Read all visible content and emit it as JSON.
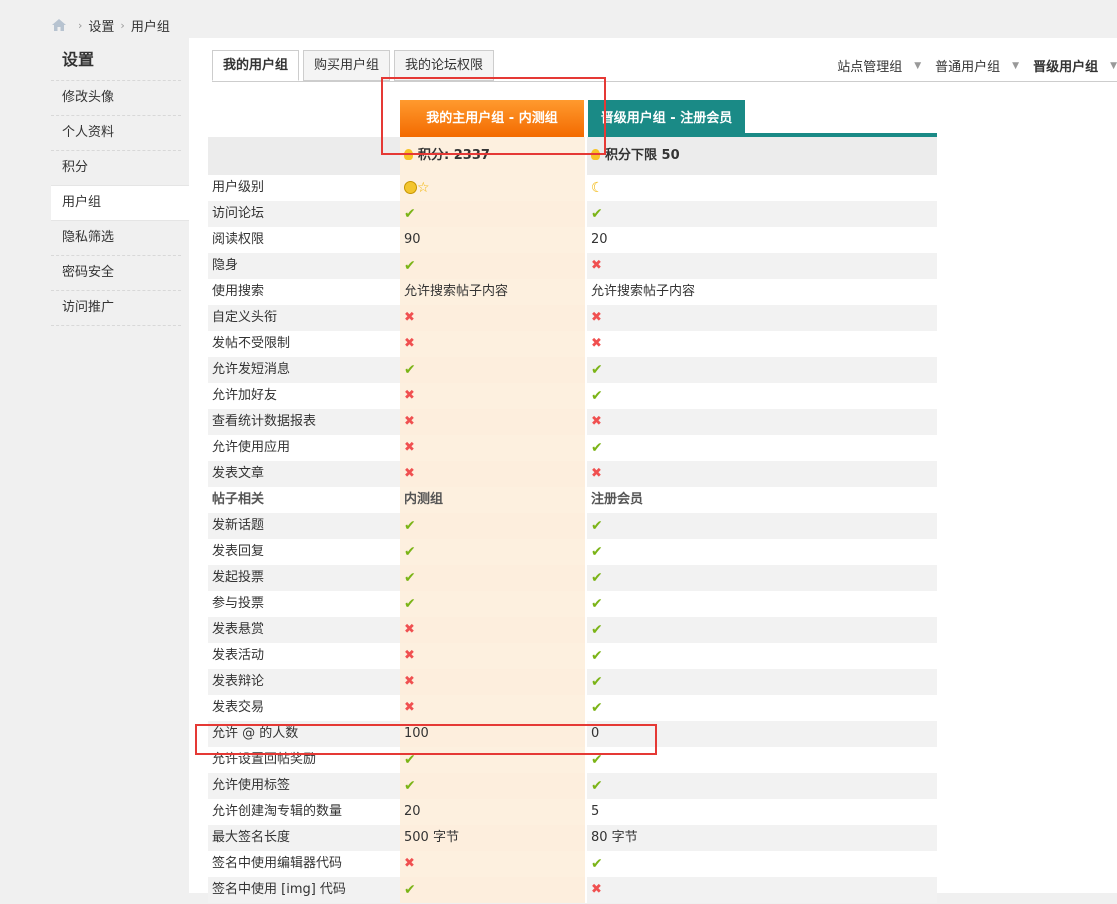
{
  "breadcrumb": {
    "home_icon": "home-icon",
    "items": [
      "设置",
      "用户组"
    ]
  },
  "sidebar": {
    "title": "设置",
    "items": [
      "修改头像",
      "个人资料",
      "积分",
      "用户组",
      "隐私筛选",
      "密码安全",
      "访问推广"
    ],
    "active_index": 3
  },
  "tabs": [
    "我的用户组",
    "购买用户组",
    "我的论坛权限"
  ],
  "group_selector": [
    "站点管理组",
    "普通用户组",
    "晋级用户组"
  ],
  "columns": {
    "mine": "我的主用户组 - 内测组",
    "next": "晋级用户组 - 注册会员"
  },
  "points": {
    "mine": "积分: 2337",
    "next": "积分下限 50"
  },
  "rows": [
    {
      "label": "用户级别",
      "mine": "icon:smile-star",
      "next": "icon:moon"
    },
    {
      "label": "访问论坛",
      "mine": "yes",
      "next": "yes"
    },
    {
      "label": "阅读权限",
      "mine": "90",
      "next": "20"
    },
    {
      "label": "隐身",
      "mine": "yes",
      "next": "no"
    },
    {
      "label": "使用搜索",
      "mine": "允许搜索帖子内容",
      "next": "允许搜索帖子内容"
    },
    {
      "label": "自定义头衔",
      "mine": "no",
      "next": "no"
    },
    {
      "label": "发帖不受限制",
      "mine": "no",
      "next": "no"
    },
    {
      "label": "允许发短消息",
      "mine": "yes",
      "next": "yes"
    },
    {
      "label": "允许加好友",
      "mine": "no",
      "next": "yes"
    },
    {
      "label": "查看统计数据报表",
      "mine": "no",
      "next": "no"
    },
    {
      "label": "允许使用应用",
      "mine": "no",
      "next": "yes"
    },
    {
      "label": "发表文章",
      "mine": "no",
      "next": "no"
    },
    {
      "label": "帖子相关",
      "mine": "内测组",
      "next": "注册会员",
      "section": true
    },
    {
      "label": "发新话题",
      "mine": "yes",
      "next": "yes"
    },
    {
      "label": "发表回复",
      "mine": "yes",
      "next": "yes"
    },
    {
      "label": "发起投票",
      "mine": "yes",
      "next": "yes"
    },
    {
      "label": "参与投票",
      "mine": "yes",
      "next": "yes"
    },
    {
      "label": "发表悬赏",
      "mine": "no",
      "next": "yes"
    },
    {
      "label": "发表活动",
      "mine": "no",
      "next": "yes"
    },
    {
      "label": "发表辩论",
      "mine": "no",
      "next": "yes"
    },
    {
      "label": "发表交易",
      "mine": "no",
      "next": "yes"
    },
    {
      "label": "允许 @ 的人数",
      "mine": "100",
      "next": "0"
    },
    {
      "label": "允许设置回帖奖励",
      "mine": "yes",
      "next": "yes"
    },
    {
      "label": "允许使用标签",
      "mine": "yes",
      "next": "yes"
    },
    {
      "label": "允许创建淘专辑的数量",
      "mine": "20",
      "next": "5"
    },
    {
      "label": "最大签名长度",
      "mine": "500 字节",
      "next": "80 字节"
    },
    {
      "label": "签名中使用编辑器代码",
      "mine": "no",
      "next": "yes"
    },
    {
      "label": "签名中使用 [img] 代码",
      "mine": "yes",
      "next": "no"
    }
  ],
  "colors": {
    "orange": "#f57f17",
    "teal": "#1a8a86",
    "yes": "#7bb417",
    "no": "#f05050",
    "highlight": "#e53935"
  }
}
